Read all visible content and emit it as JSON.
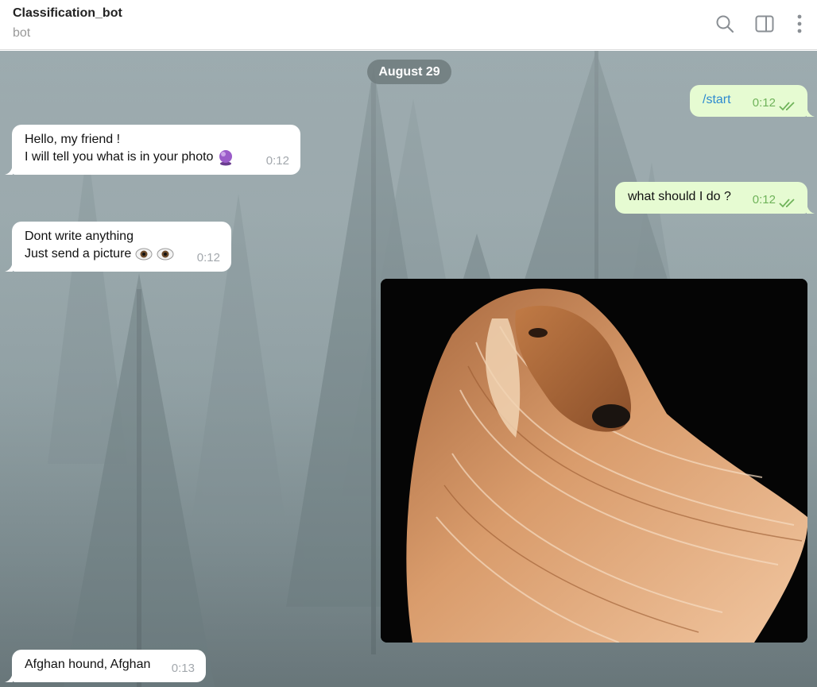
{
  "header": {
    "title": "Classification_bot",
    "subtitle": "bot",
    "icons": [
      "search-icon",
      "sidebar-toggle-icon",
      "more-vertical-icon"
    ]
  },
  "chat": {
    "date_label": "August 29",
    "messages": [
      {
        "direction": "out",
        "lines": [
          "/start"
        ],
        "time": "0:12",
        "status": "read"
      },
      {
        "direction": "in",
        "lines": [
          "Hello, my friend !",
          " I will tell you what is in your photo"
        ],
        "emoji": "crystal-ball",
        "time": "0:12"
      },
      {
        "direction": "out",
        "lines": [
          "what should I do ?"
        ],
        "time": "0:12",
        "status": "read"
      },
      {
        "direction": "in",
        "lines": [
          "Dont write anything",
          " Just send a picture"
        ],
        "emoji": "eyes",
        "time": "0:12"
      },
      {
        "direction": "out",
        "type": "photo",
        "subject": "Afghan hound photo"
      },
      {
        "direction": "in",
        "lines": [
          "Afghan hound, Afghan"
        ],
        "time": "0:13"
      }
    ]
  },
  "colors": {
    "incoming_bubble": "#ffffff",
    "outgoing_bubble": "#e6fbd2",
    "command_link": "#2d8ad0",
    "read_check": "#6fb35a",
    "date_pill": "#6e7a7d"
  }
}
